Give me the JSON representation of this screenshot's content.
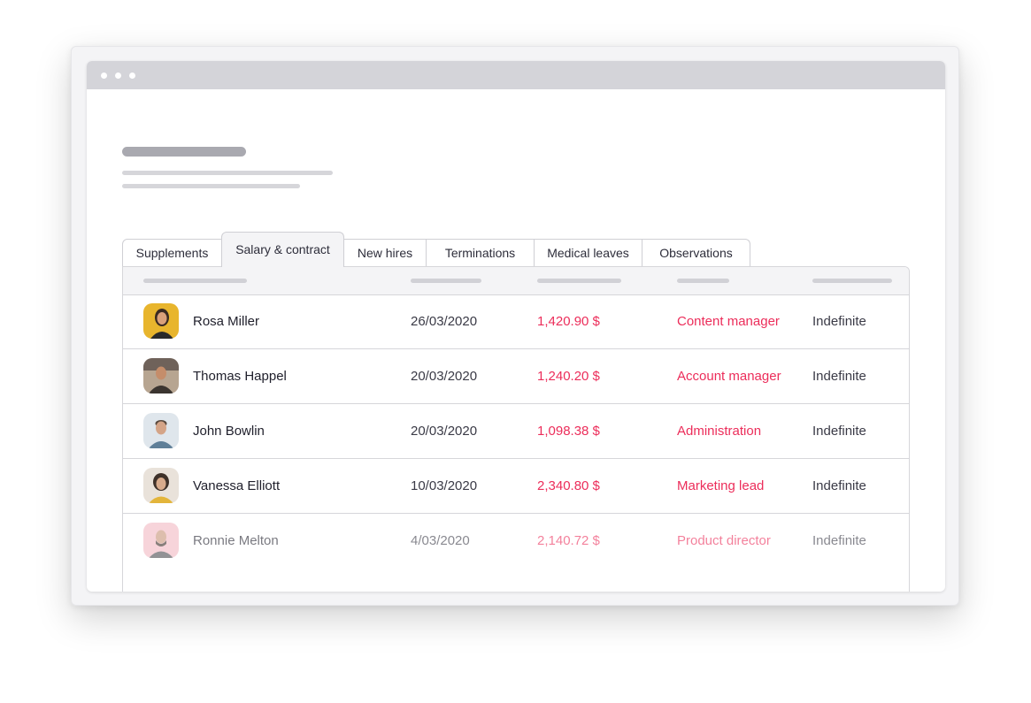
{
  "tabs": [
    {
      "label": "Supplements",
      "active": false
    },
    {
      "label": "Salary & contract",
      "active": true
    },
    {
      "label": "New hires",
      "active": false
    },
    {
      "label": "Terminations",
      "active": false
    },
    {
      "label": "Medical leaves",
      "active": false
    },
    {
      "label": "Observations",
      "active": false
    }
  ],
  "rows": [
    {
      "name": "Rosa Miller",
      "date": "26/03/2020",
      "salary": "1,420.90 $",
      "role": "Content manager",
      "contract": "Indefinite"
    },
    {
      "name": "Thomas Happel",
      "date": "20/03/2020",
      "salary": "1,240.20 $",
      "role": "Account manager",
      "contract": "Indefinite"
    },
    {
      "name": "John Bowlin",
      "date": "20/03/2020",
      "salary": "1,098.38 $",
      "role": "Administration",
      "contract": "Indefinite"
    },
    {
      "name": "Vanessa Elliott",
      "date": "10/03/2020",
      "salary": "2,340.80 $",
      "role": "Marketing lead",
      "contract": "Indefinite"
    },
    {
      "name": "Ronnie Melton",
      "date": "4/03/2020",
      "salary": "2,140.72 $",
      "role": "Product director",
      "contract": "Indefinite"
    }
  ],
  "colors": {
    "accent": "#ec2d5a",
    "titlebar": "#d4d4d9",
    "header_bg": "#f4f4f6"
  }
}
